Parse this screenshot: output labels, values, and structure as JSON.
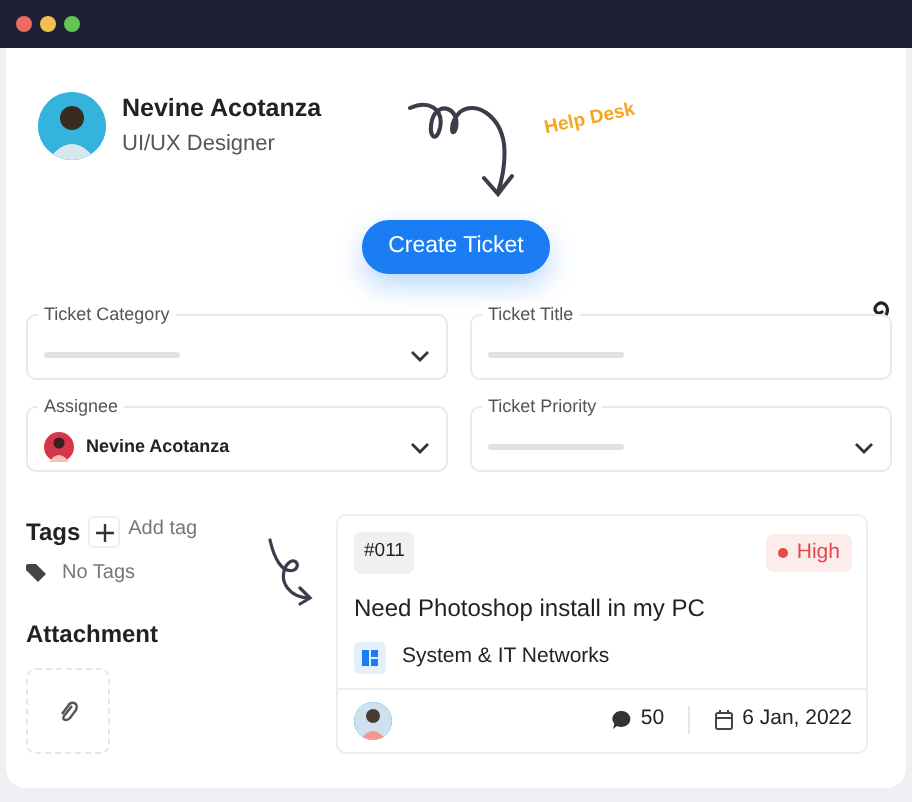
{
  "window": {
    "controls": [
      {
        "color": "#ec6a5e"
      },
      {
        "color": "#f4bf4f"
      },
      {
        "color": "#61c554"
      }
    ]
  },
  "profile": {
    "name": "Nevine Acotanza",
    "role": "UI/UX Designer"
  },
  "annotation": "Help Desk",
  "create_button": "Create Ticket",
  "fields": [
    {
      "label": "Ticket Category",
      "kind": "select"
    },
    {
      "label": "Ticket Title",
      "kind": "input"
    },
    {
      "label": "Assignee",
      "kind": "select",
      "value": "Nevine Acotanza"
    },
    {
      "label": "Ticket Priority",
      "kind": "select"
    }
  ],
  "tags": {
    "title": "Tags",
    "add_label": "Add tag",
    "empty_text": "No Tags"
  },
  "attachment": {
    "title": "Attachment"
  },
  "ticket": {
    "id": "#011",
    "priority": {
      "label": "High",
      "color": "#e5484d"
    },
    "title": "Need Photoshop install in my PC",
    "category": "System & IT Networks",
    "comments": "50",
    "date": "6 Jan, 2022"
  }
}
